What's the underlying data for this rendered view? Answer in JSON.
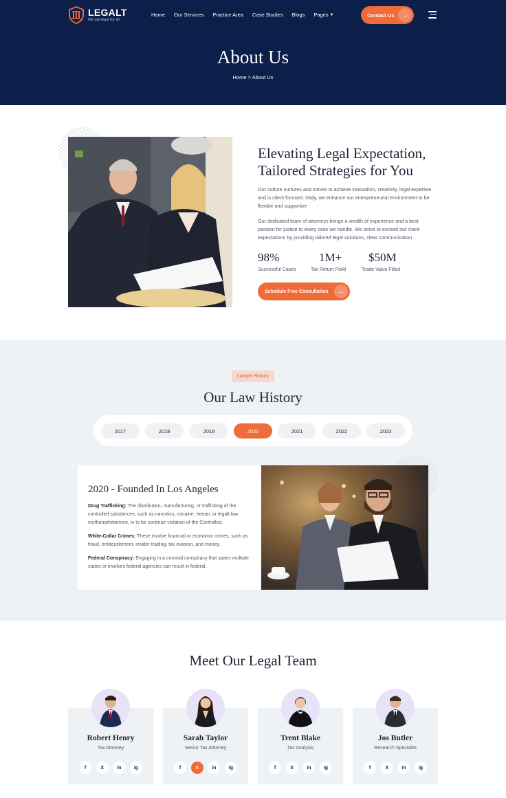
{
  "brand": {
    "name": "LEGALT",
    "tagline": "We are legal for all",
    "accent": "#ef6c3a",
    "navy": "#0c1e4a"
  },
  "nav": {
    "items": [
      "Home",
      "Our Services",
      "Practice Area",
      "Case Studies",
      "Blogs",
      "Pages"
    ],
    "contact_label": "Contact Us"
  },
  "hero": {
    "title": "About Us",
    "breadcrumb": "Home > About Us"
  },
  "about": {
    "heading": "Elevating Legal Expectation, Tailored Strategies for You",
    "para1": "Our culture nurtures and strives to achieve innovation, creativity, legal expertise and is client focused. Daily, we enhance our entrepreneurial environment to be flexible and supportive",
    "para2": "Our dedicated team of attorneys brings a wealth of experience and a best passion for justice to every case we handle. We strive to exceed our client expectations by providing tailored legal solutions, clear communication",
    "stats": [
      {
        "value": "98%",
        "label": "Successful Cases"
      },
      {
        "value": "1M+",
        "label": "Tax Return Field"
      },
      {
        "value": "$50M",
        "label": "Trade Value Filled"
      }
    ],
    "cta_label": "Schedule Free Consultation"
  },
  "history": {
    "tag": "Lawyer History",
    "title": "Our Law History",
    "years": [
      "2017",
      "2018",
      "2019",
      "2020",
      "2021",
      "2022",
      "2023"
    ],
    "active_year": "2020",
    "card_title": "2020 - Founded In Los Angeles",
    "items": [
      {
        "label": "Drug Trafficking:",
        "text": " The distribution, manufacturing, or trafficking of the controlled substances, such as narcotics, cocaine, heroin, or legalt law methamphetamine, in to be continue  violation of the Controlled."
      },
      {
        "label": "White-Collar Crimes:",
        "text": " These involve financial or economic crimes, such as fraud, embezzlement, insider trading, tax evasion, and money."
      },
      {
        "label": "Federal Conspiracy:",
        "text": " Engaging in a criminal conspiracy that spans multiple states or involves federal agencies can result in federal."
      }
    ]
  },
  "team": {
    "title": "Meet Our Legal Team",
    "members": [
      {
        "name": "Robert Henry",
        "role": "Tax Attorney"
      },
      {
        "name": "Sarah Taylor",
        "role": "Senior Tax Attorney"
      },
      {
        "name": "Trent Blake",
        "role": "Tax Analysis"
      },
      {
        "name": "Jos Butler",
        "role": "Research Specialist"
      }
    ],
    "social_icons": [
      "facebook-icon",
      "x-icon",
      "linkedin-icon",
      "instagram-icon"
    ],
    "social_glyphs": [
      "f",
      "X",
      "in",
      "ig"
    ]
  }
}
